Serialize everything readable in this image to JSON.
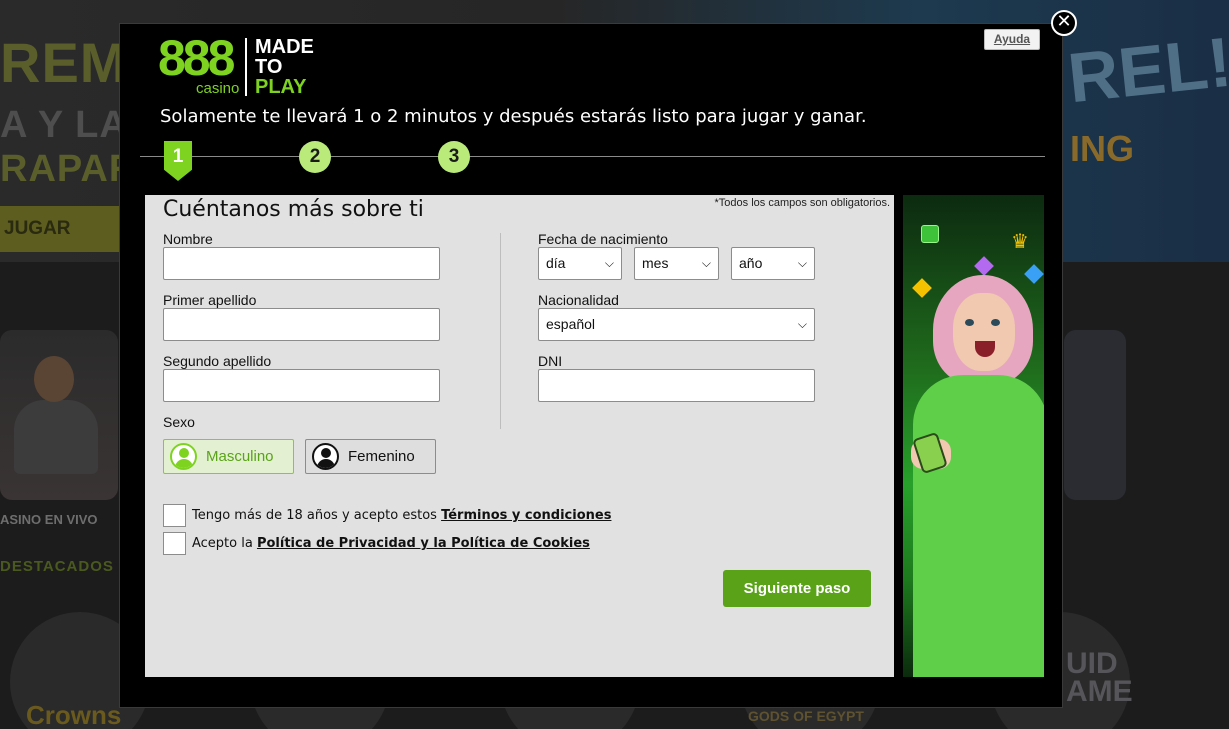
{
  "background": {
    "hero_text_1": "REMI",
    "hero_text_2": "A Y LA",
    "hero_text_3": "RAPAR",
    "jugar_button": "JUGAR",
    "reel_text": "REL!",
    "ing_text": "ING",
    "casino_en_vivo": "ASINO EN VIVO",
    "destacados": "DESTACADOS",
    "crowns": "Crowns",
    "gods_of_egypt": "GODS OF EGYPT",
    "squid_game": "UID\nAME"
  },
  "modal": {
    "help_label": "Ayuda",
    "close_symbol": "✕",
    "logo": {
      "brand": "888",
      "sub": "casino",
      "tagline_1": "MADE",
      "tagline_2": "TO",
      "tagline_3": "PLAY"
    },
    "subtitle": "Solamente te llevará 1 o 2 minutos y después estarás listo para jugar y ganar.",
    "steps": [
      "1",
      "2",
      "3"
    ],
    "active_step": 1
  },
  "form": {
    "title": "Cuéntanos más sobre ti",
    "required_note": "*Todos los campos son obligatorios.",
    "nombre_label": "Nombre",
    "nombre_value": "",
    "primer_apellido_label": "Primer apellido",
    "primer_apellido_value": "",
    "segundo_apellido_label": "Segundo apellido",
    "segundo_apellido_value": "",
    "sexo_label": "Sexo",
    "gender_options": [
      "Masculino",
      "Femenino"
    ],
    "selected_gender": "Masculino",
    "fecha_label": "Fecha de nacimiento",
    "dia_value": "día",
    "mes_value": "mes",
    "anio_value": "año",
    "nacionalidad_label": "Nacionalidad",
    "nacionalidad_value": "español",
    "dni_label": "DNI",
    "dni_value": "",
    "terms_prefix": "Tengo más de 18 años y acepto estos ",
    "terms_link": "Términos y condiciones",
    "privacy_prefix": "Acepto la ",
    "privacy_link": "Política de Privacidad y la Política de Cookies",
    "next_button": "Siguiente paso"
  },
  "colors": {
    "brand_green": "#7ed321",
    "button_green": "#5aa318",
    "panel_gray": "#e1e1e1",
    "modal_black": "#000000"
  }
}
